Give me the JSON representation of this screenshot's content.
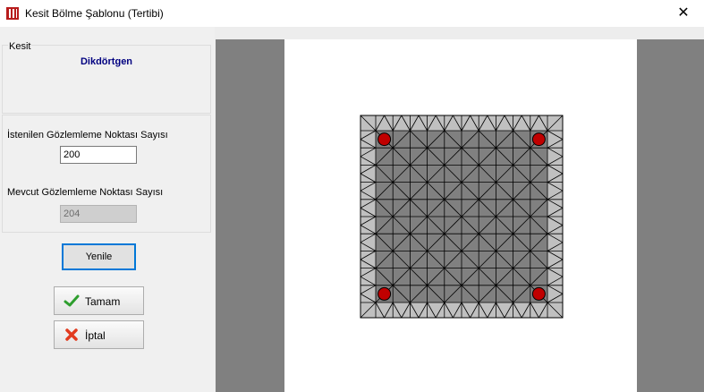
{
  "window": {
    "title": "Kesit Bölme Şablonu (Tertibi)",
    "close_glyph": "✕"
  },
  "section_group": {
    "label": "Kesit",
    "section_name": "Dikdörtgen"
  },
  "points_group": {
    "requested_label": "İstenilen Gözlemleme Noktası Sayısı",
    "requested_value": "200",
    "current_label": "Mevcut Gözlemleme Noktası Sayısı",
    "current_value": "204"
  },
  "buttons": {
    "refresh": "Yenile",
    "ok": "Tamam",
    "cancel": "İptal"
  },
  "icons": {
    "app": "app-icon",
    "ok": "check-icon",
    "cancel": "x-icon",
    "close": "close-icon"
  },
  "colors": {
    "side_gray": "#808080",
    "page_white": "#ffffff",
    "cover_fill": "#c0c0c0",
    "core_fill": "#808080",
    "rebar": "#c00000",
    "ok_green": "#2e9e2e",
    "cancel_red": "#e23b1f",
    "accent_blue": "#0078d7",
    "title_navy": "#000080"
  },
  "section": {
    "grid_cells": 10,
    "cover_fraction": 0.075,
    "rebars": 4
  }
}
